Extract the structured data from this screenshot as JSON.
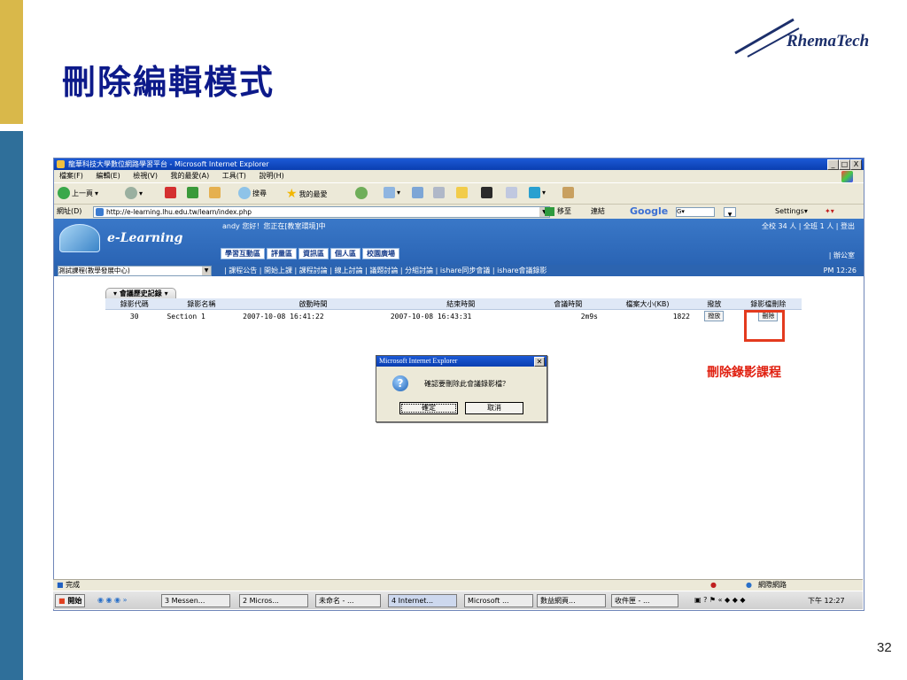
{
  "slide": {
    "title": "刪除編輯模式",
    "logo_text": "RhemaTech",
    "page_number": "32",
    "annotation": "刪除錄影課程"
  },
  "window": {
    "title": "龍華科技大學數位網路學習平台 - Microsoft Internet Explorer",
    "controls": [
      "_",
      "□",
      "X"
    ]
  },
  "menu": [
    "檔案(F)",
    "編輯(E)",
    "檢視(V)",
    "我的最愛(A)",
    "工具(T)",
    "說明(H)"
  ],
  "toolbar": {
    "back": "上一頁",
    "search": "搜尋",
    "favorites": "我的最愛"
  },
  "address": {
    "label": "網址(D)",
    "url": "http://e-learning.lhu.edu.tw/learn/index.php",
    "go": "移至",
    "links": "連結",
    "google": "Google",
    "settings": "Settings▾"
  },
  "site": {
    "brand": "e-Learning",
    "greeting": "andy 您好！您正在[教室環境]中",
    "online": "全校 34 人 | 全班 1 人 | 登出",
    "office": "| 辦公室",
    "tabs": [
      "學習互動區",
      "評量區",
      "資訊區",
      "個人區",
      "校園廣場"
    ],
    "course_select": "測試課程(教學發展中心)",
    "subnav": "| 課程公告 | 開始上課 | 課程討論 | 線上討論 | 議題討論 | 分組討論 | ishare同步會議 | ishare會議錄影",
    "time": "PM 12:26"
  },
  "records": {
    "tab_label": "會議歷史記錄",
    "headers": [
      "錄影代碼",
      "錄影名稱",
      "啟動時間",
      "結束時間",
      "會議時間",
      "檔案大小(KB)",
      "撥放",
      "錄影檔刪除"
    ],
    "rows": [
      {
        "id": "30",
        "name": "Section 1",
        "start": "2007-10-08 16:41:22",
        "end": "2007-10-08 16:43:31",
        "duration": "2m9s",
        "size": "1822",
        "play": "撥放",
        "delete": "刪除"
      }
    ]
  },
  "dialog": {
    "title": "Microsoft Internet Explorer",
    "message": "確認要刪除此會議錄影檔？",
    "ok": "確定",
    "cancel": "取消"
  },
  "status": {
    "left": "完成",
    "right": "網際網路"
  },
  "taskbar": {
    "start": "開始",
    "items": [
      "3 Messen...",
      "2 Micros...",
      "未命名 - ...",
      "4 Internet...",
      "Microsoft ...",
      "數益網頁...",
      "收件匣 - ..."
    ],
    "clock": "下午 12:27"
  }
}
